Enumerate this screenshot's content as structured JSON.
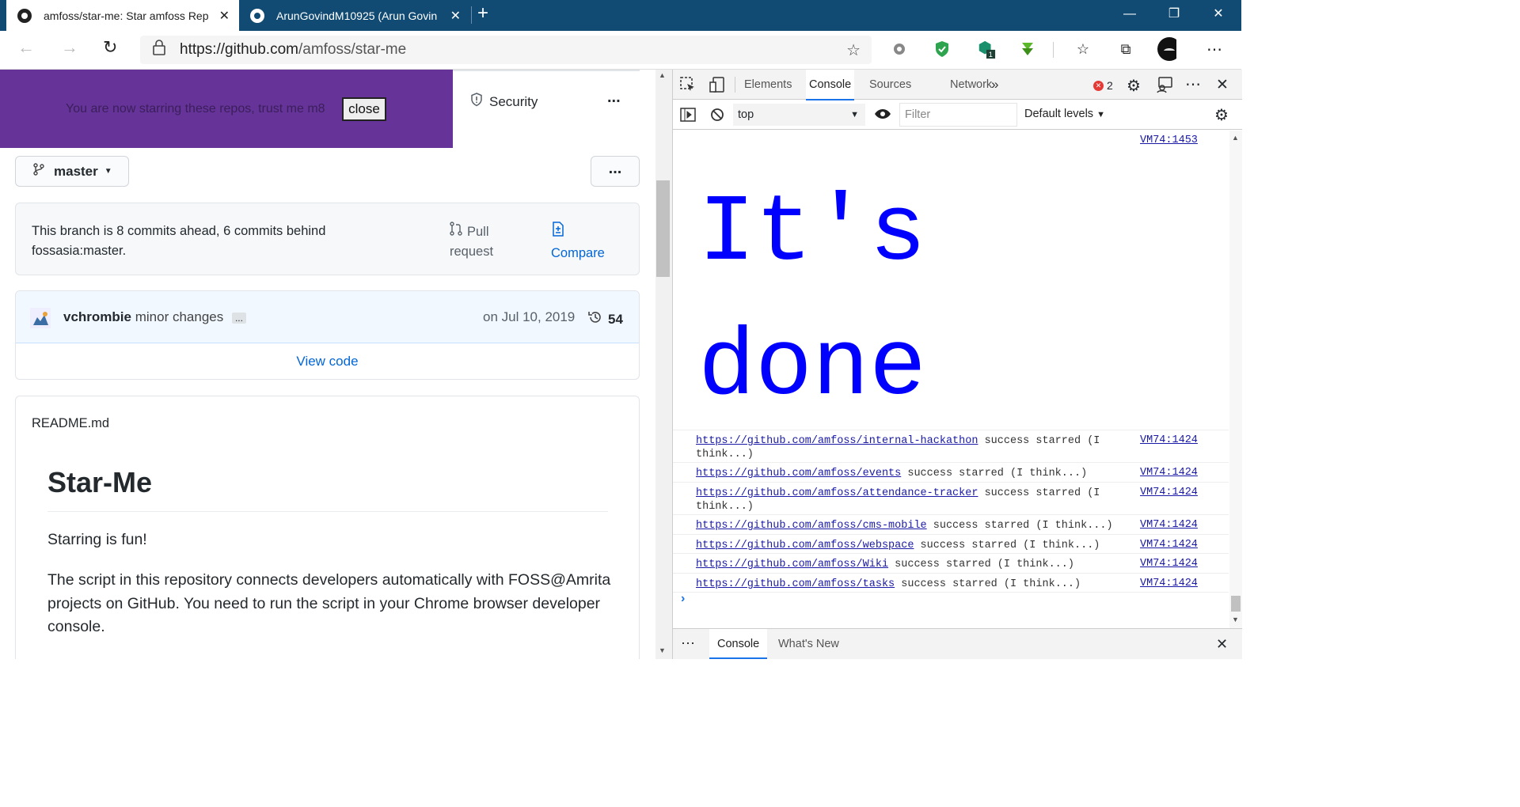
{
  "browser": {
    "tabs": [
      {
        "title": "amfoss/star-me: Star amfoss Rep",
        "active": true
      },
      {
        "title": "ArunGovindM10925 (Arun Govin",
        "active": false
      }
    ],
    "new_tab_symbol": "+",
    "url_domain": "https://github.com",
    "url_path": "/amfoss/star-me"
  },
  "banner": {
    "text": "You are now starring these repos, trust me m8",
    "close_label": "close",
    "color": "#663399"
  },
  "repo": {
    "security_label": "Security",
    "more_label": "...",
    "branch": "master",
    "branch_status_line1": "This branch is 8 commits ahead, 6 commits behind",
    "branch_status_line2": "fossasia:master.",
    "pull_label_1": "Pull",
    "pull_label_2": "request",
    "compare_label": "Compare",
    "commit_author": "vchrombie",
    "commit_message": "minor changes",
    "commit_ellipsis": "...",
    "commit_date": "on Jul 10, 2019",
    "commit_count": "54",
    "view_code": "View code",
    "readme_filename": "README.md",
    "readme_title": "Star-Me",
    "readme_p1": "Starring is fun!",
    "readme_p2_l1": "The script in this repository connects developers automatically with FOSS@Amrita",
    "readme_p2_l2": "projects on GitHub. You need to run the script in your Chrome browser developer",
    "readme_p2_l3": "console."
  },
  "devtools": {
    "tabs": [
      "Elements",
      "Console",
      "Sources",
      "Network"
    ],
    "active_tab": "Console",
    "overflow": "»",
    "error_count": "2",
    "context": "top",
    "filter_placeholder": "Filter",
    "levels": "Default levels",
    "big_src": "VM74:1453",
    "big_line1": "It's",
    "big_line2": "done",
    "big_color": "#0000ff",
    "logs": [
      {
        "url": "https://github.com/amfoss/internal-hackathon",
        "msg": " success starred (I think...)",
        "src": "VM74:1424"
      },
      {
        "url": "https://github.com/amfoss/events",
        "msg": " success starred (I think...)",
        "src": "VM74:1424"
      },
      {
        "url": "https://github.com/amfoss/attendance-tracker",
        "msg": " success starred (I think...)",
        "src": "VM74:1424"
      },
      {
        "url": "https://github.com/amfoss/cms-mobile",
        "msg": " success starred (I think...)",
        "src": "VM74:1424"
      },
      {
        "url": "https://github.com/amfoss/webspace",
        "msg": " success starred (I think...)",
        "src": "VM74:1424"
      },
      {
        "url": "https://github.com/amfoss/Wiki",
        "msg": " success starred (I think...)",
        "src": "VM74:1424"
      },
      {
        "url": "https://github.com/amfoss/tasks",
        "msg": " success starred (I think...)",
        "src": "VM74:1424"
      }
    ],
    "prompt": "›",
    "drawer_more": "⋮",
    "drawer_tabs": [
      "Console",
      "What's New"
    ]
  }
}
